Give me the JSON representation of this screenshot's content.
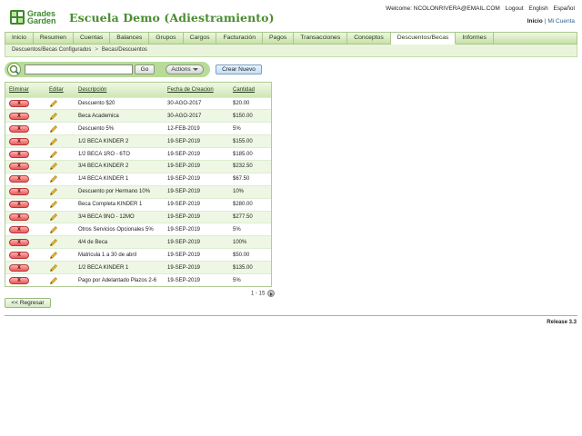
{
  "header": {
    "logo_line1": "Grades",
    "logo_line2": "Garden",
    "school_name": "Escuela Demo (Adiestramiento)",
    "welcome": "Welcome: NCOLONRIVERA@EMAIL.COM",
    "logout": "Logout",
    "english": "English",
    "espanol": "Español",
    "inicio": "Inicio",
    "separator": "|",
    "mi_cuenta": "Mi Cuenta"
  },
  "nav": {
    "tabs": [
      "Inicio",
      "Resumen",
      "Cuentas",
      "Balances",
      "Grupos",
      "Cargos",
      "Facturación",
      "Pagos",
      "Transacciones",
      "Conceptos",
      "Descuentos/Becas",
      "Informes"
    ],
    "active_index": 10
  },
  "breadcrumb": {
    "item1": "Descuentos/Becas Configurados",
    "separator": ">",
    "item2": "Becas/Descuentos"
  },
  "toolbar": {
    "search_value": "",
    "go_label": "Go",
    "actions_label": "Actions",
    "crear_label": "Crear Nuevo"
  },
  "table": {
    "columns": [
      "Eliminar",
      "Editar",
      "Descripción",
      "Fecha de Creacion",
      "Cantidad"
    ],
    "delete_label": "X",
    "rows": [
      {
        "descripcion": "Descuento $20",
        "fecha": "30-AGO-2017",
        "cantidad": "$20.00"
      },
      {
        "descripcion": "Beca Academica",
        "fecha": "30-AGO-2017",
        "cantidad": "$150.00"
      },
      {
        "descripcion": "Descuento 5%",
        "fecha": "12-FEB-2019",
        "cantidad": "5%"
      },
      {
        "descripcion": "1/2 BECA KINDER 2",
        "fecha": "19-SEP-2019",
        "cantidad": "$155.00"
      },
      {
        "descripcion": "1/2 BECA 1RO - 6TO",
        "fecha": "19-SEP-2019",
        "cantidad": "$185.00"
      },
      {
        "descripcion": "3/4 BECA KINDER 2",
        "fecha": "19-SEP-2019",
        "cantidad": "$232.50"
      },
      {
        "descripcion": "1/4 BECA KINDER 1",
        "fecha": "19-SEP-2019",
        "cantidad": "$67.50"
      },
      {
        "descripcion": "Descuento por Hermano 10%",
        "fecha": "19-SEP-2019",
        "cantidad": "10%"
      },
      {
        "descripcion": "Beca Completa KINDER 1",
        "fecha": "19-SEP-2019",
        "cantidad": "$280.00"
      },
      {
        "descripcion": "3/4 BECA 9NO - 12MO",
        "fecha": "19-SEP-2019",
        "cantidad": "$277.50"
      },
      {
        "descripcion": "Otros Servicios Opcionales 5%",
        "fecha": "19-SEP-2019",
        "cantidad": "5%"
      },
      {
        "descripcion": "4/4 de Beca",
        "fecha": "19-SEP-2019",
        "cantidad": "100%"
      },
      {
        "descripcion": "Matricula 1 a 30 de abril",
        "fecha": "19-SEP-2019",
        "cantidad": "$50.00"
      },
      {
        "descripcion": "1/2 BECA KINDER 1",
        "fecha": "19-SEP-2019",
        "cantidad": "$135.00"
      },
      {
        "descripcion": "Pago por Adelantado Plazos 2-6",
        "fecha": "19-SEP-2019",
        "cantidad": "5%"
      }
    ],
    "pager_text": "1 - 15"
  },
  "footer": {
    "back_label": "<< Regresar",
    "release": "Release 3.3"
  },
  "colors": {
    "brand_green": "#4a8c30",
    "nav_bg": "#c8e0a8",
    "delete_red": "#e85a5a"
  },
  "icons": {
    "logo": "grades-garden-logo",
    "toolbar": "refresh-search-icon",
    "edit": "pencil-icon",
    "pager_next": "next-page-icon"
  }
}
